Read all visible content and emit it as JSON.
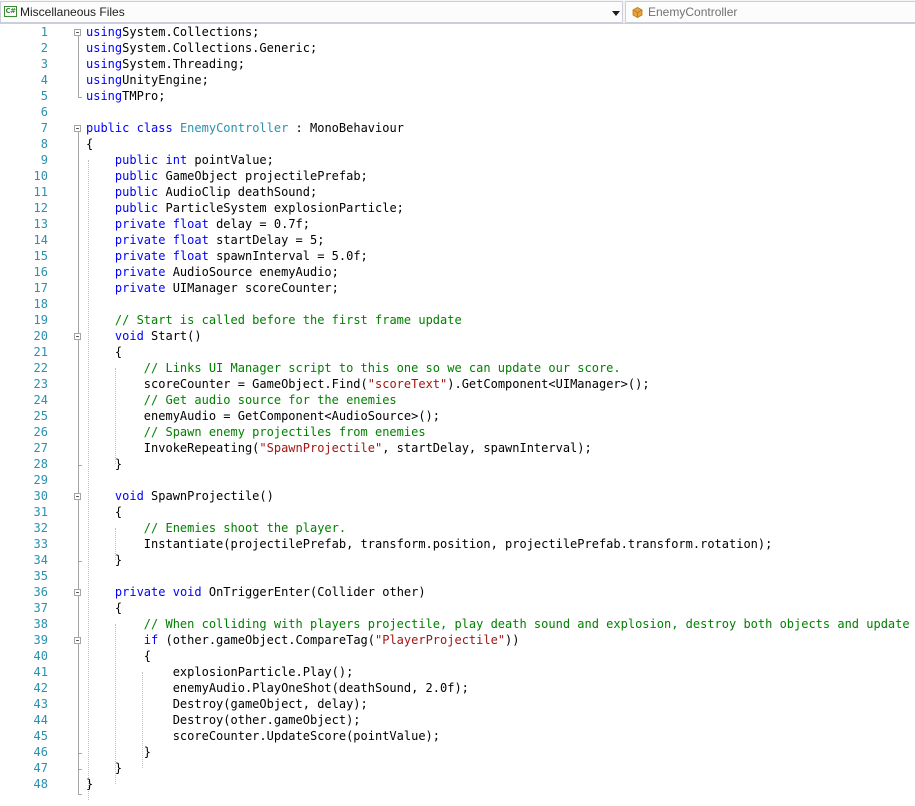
{
  "navbar": {
    "project_label": "Miscellaneous Files",
    "project_icon": "C#",
    "type_label": "EnemyController"
  },
  "code_lines": [
    {
      "n": "1",
      "t": [
        [
          "kw",
          "using"
        ],
        [
          "",
          "System.Collections;"
        ]
      ]
    },
    {
      "n": "2",
      "t": [
        [
          "kw",
          "using"
        ],
        [
          "",
          "System.Collections.Generic;"
        ]
      ]
    },
    {
      "n": "3",
      "t": [
        [
          "kw",
          "using"
        ],
        [
          "",
          "System.Threading;"
        ]
      ]
    },
    {
      "n": "4",
      "t": [
        [
          "kw",
          "using"
        ],
        [
          "",
          "UnityEngine;"
        ]
      ]
    },
    {
      "n": "5",
      "t": [
        [
          "kw",
          "using"
        ],
        [
          "",
          "TMPro;"
        ]
      ]
    },
    {
      "n": "6",
      "t": []
    },
    {
      "n": "7",
      "t": [
        [
          "kw",
          "public"
        ],
        [
          "",
          " "
        ],
        [
          "kw",
          "class"
        ],
        [
          "",
          " "
        ],
        [
          "ty",
          "EnemyController"
        ],
        [
          "",
          " : MonoBehaviour"
        ]
      ]
    },
    {
      "n": "8",
      "t": [
        [
          "",
          "{"
        ]
      ]
    },
    {
      "n": "9",
      "t": [
        [
          "",
          "    "
        ],
        [
          "kw",
          "public"
        ],
        [
          "",
          " "
        ],
        [
          "kw",
          "int"
        ],
        [
          "",
          " pointValue;"
        ]
      ]
    },
    {
      "n": "10",
      "t": [
        [
          "",
          "    "
        ],
        [
          "kw",
          "public"
        ],
        [
          "",
          " GameObject projectilePrefab;"
        ]
      ]
    },
    {
      "n": "11",
      "t": [
        [
          "",
          "    "
        ],
        [
          "kw",
          "public"
        ],
        [
          "",
          " AudioClip deathSound;"
        ]
      ]
    },
    {
      "n": "12",
      "t": [
        [
          "",
          "    "
        ],
        [
          "kw",
          "public"
        ],
        [
          "",
          " ParticleSystem explosionParticle;"
        ]
      ]
    },
    {
      "n": "13",
      "t": [
        [
          "",
          "    "
        ],
        [
          "kw",
          "private"
        ],
        [
          "",
          " "
        ],
        [
          "kw",
          "float"
        ],
        [
          "",
          " delay = 0.7f;"
        ]
      ]
    },
    {
      "n": "14",
      "t": [
        [
          "",
          "    "
        ],
        [
          "kw",
          "private"
        ],
        [
          "",
          " "
        ],
        [
          "kw",
          "float"
        ],
        [
          "",
          " startDelay = 5;"
        ]
      ]
    },
    {
      "n": "15",
      "t": [
        [
          "",
          "    "
        ],
        [
          "kw",
          "private"
        ],
        [
          "",
          " "
        ],
        [
          "kw",
          "float"
        ],
        [
          "",
          " spawnInterval = 5.0f;"
        ]
      ]
    },
    {
      "n": "16",
      "t": [
        [
          "",
          "    "
        ],
        [
          "kw",
          "private"
        ],
        [
          "",
          " AudioSource enemyAudio;"
        ]
      ]
    },
    {
      "n": "17",
      "t": [
        [
          "",
          "    "
        ],
        [
          "kw",
          "private"
        ],
        [
          "",
          " UIManager scoreCounter;"
        ]
      ]
    },
    {
      "n": "18",
      "t": []
    },
    {
      "n": "19",
      "t": [
        [
          "",
          "    "
        ],
        [
          "cm",
          "// Start is called before the first frame update"
        ]
      ]
    },
    {
      "n": "20",
      "t": [
        [
          "",
          "    "
        ],
        [
          "kw",
          "void"
        ],
        [
          "",
          " Start()"
        ]
      ]
    },
    {
      "n": "21",
      "t": [
        [
          "",
          "    {"
        ]
      ]
    },
    {
      "n": "22",
      "t": [
        [
          "",
          "        "
        ],
        [
          "cm",
          "// Links UI Manager script to this one so we can update our score."
        ]
      ]
    },
    {
      "n": "23",
      "t": [
        [
          "",
          "        scoreCounter = GameObject.Find("
        ],
        [
          "st",
          "\"scoreText\""
        ],
        [
          "",
          ").GetComponent<UIManager>();"
        ]
      ]
    },
    {
      "n": "24",
      "t": [
        [
          "",
          "        "
        ],
        [
          "cm",
          "// Get audio source for the enemies"
        ]
      ]
    },
    {
      "n": "25",
      "t": [
        [
          "",
          "        enemyAudio = GetComponent<AudioSource>();"
        ]
      ]
    },
    {
      "n": "26",
      "t": [
        [
          "",
          "        "
        ],
        [
          "cm",
          "// Spawn enemy projectiles from enemies"
        ]
      ]
    },
    {
      "n": "27",
      "t": [
        [
          "",
          "        InvokeRepeating("
        ],
        [
          "st",
          "\"SpawnProjectile\""
        ],
        [
          "",
          ", startDelay, spawnInterval);"
        ]
      ]
    },
    {
      "n": "28",
      "t": [
        [
          "",
          "    }"
        ]
      ]
    },
    {
      "n": "29",
      "t": []
    },
    {
      "n": "30",
      "t": [
        [
          "",
          "    "
        ],
        [
          "kw",
          "void"
        ],
        [
          "",
          " SpawnProjectile()"
        ]
      ]
    },
    {
      "n": "31",
      "t": [
        [
          "",
          "    {"
        ]
      ]
    },
    {
      "n": "32",
      "t": [
        [
          "",
          "        "
        ],
        [
          "cm",
          "// Enemies shoot the player."
        ]
      ]
    },
    {
      "n": "33",
      "t": [
        [
          "",
          "        Instantiate(projectilePrefab, transform.position, projectilePrefab.transform.rotation);"
        ]
      ]
    },
    {
      "n": "34",
      "t": [
        [
          "",
          "    }"
        ]
      ]
    },
    {
      "n": "35",
      "t": []
    },
    {
      "n": "36",
      "t": [
        [
          "",
          "    "
        ],
        [
          "kw",
          "private"
        ],
        [
          "",
          " "
        ],
        [
          "kw",
          "void"
        ],
        [
          "",
          " OnTriggerEnter(Collider other)"
        ]
      ]
    },
    {
      "n": "37",
      "t": [
        [
          "",
          "    {"
        ]
      ]
    },
    {
      "n": "38",
      "t": [
        [
          "",
          "        "
        ],
        [
          "cm",
          "// When colliding with players projectile, play death sound and explosion, destroy both objects and update score."
        ]
      ]
    },
    {
      "n": "39",
      "t": [
        [
          "",
          "        "
        ],
        [
          "kw",
          "if"
        ],
        [
          "",
          " (other.gameObject.CompareTag("
        ],
        [
          "st",
          "\"PlayerProjectile\""
        ],
        [
          "",
          "))"
        ]
      ]
    },
    {
      "n": "40",
      "t": [
        [
          "",
          "        {"
        ]
      ]
    },
    {
      "n": "41",
      "t": [
        [
          "",
          "            explosionParticle.Play();"
        ]
      ]
    },
    {
      "n": "42",
      "t": [
        [
          "",
          "            enemyAudio.PlayOneShot(deathSound, 2.0f);"
        ]
      ]
    },
    {
      "n": "43",
      "t": [
        [
          "",
          "            Destroy(gameObject, delay);"
        ]
      ]
    },
    {
      "n": "44",
      "t": [
        [
          "",
          "            Destroy(other.gameObject);"
        ]
      ]
    },
    {
      "n": "45",
      "t": [
        [
          "",
          "            scoreCounter.UpdateScore(pointValue);"
        ]
      ]
    },
    {
      "n": "46",
      "t": [
        [
          "",
          "        }"
        ]
      ]
    },
    {
      "n": "47",
      "t": [
        [
          "",
          "    }"
        ]
      ]
    },
    {
      "n": "48",
      "t": [
        [
          "",
          "}"
        ]
      ]
    }
  ]
}
